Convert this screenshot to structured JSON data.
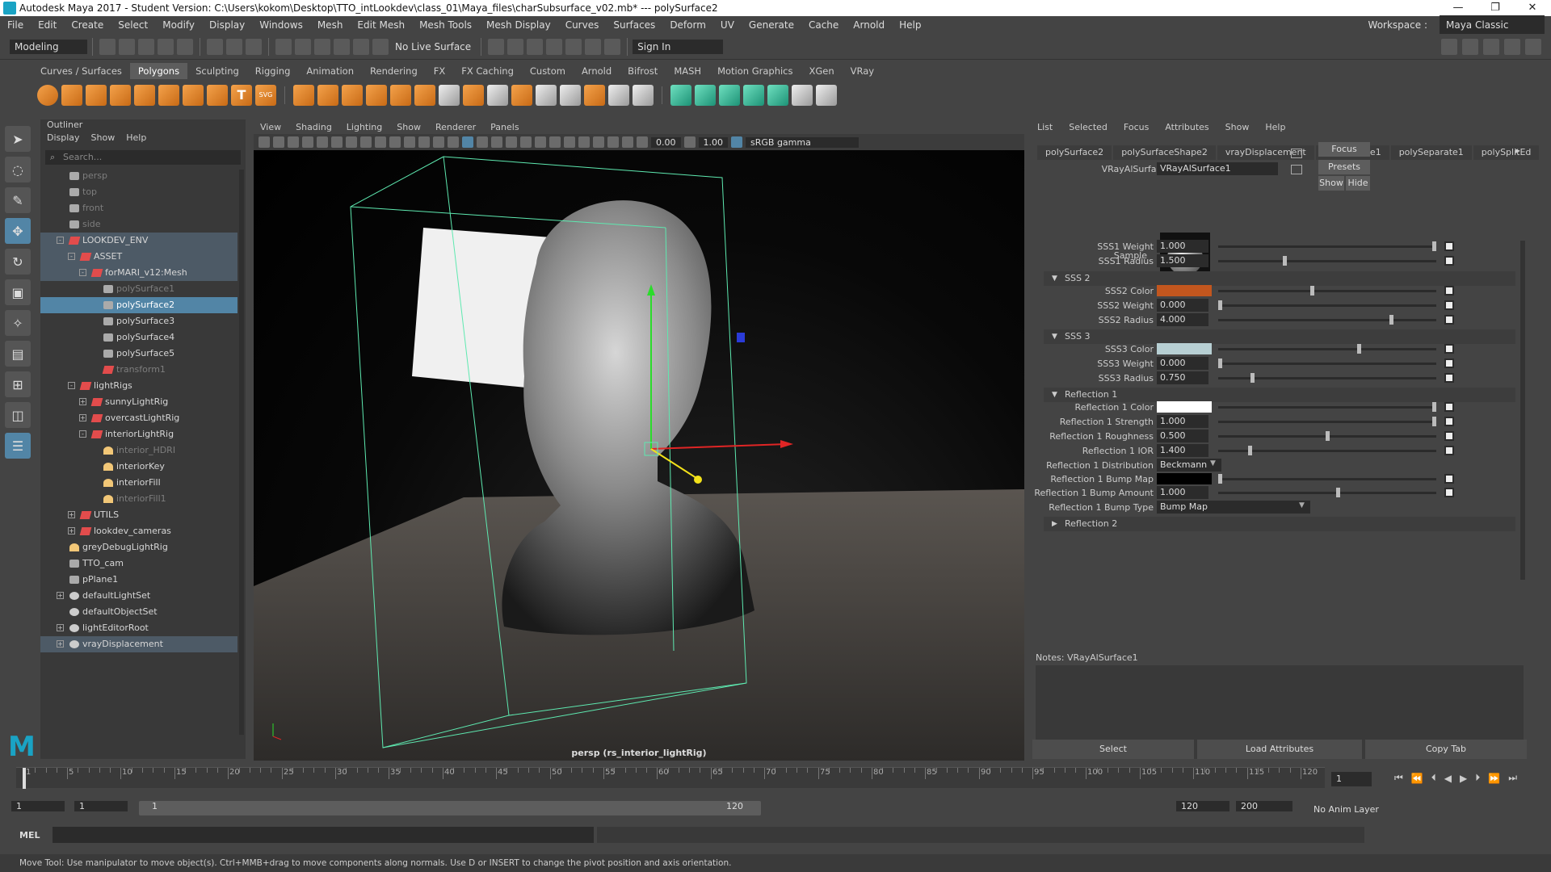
{
  "window": {
    "title": "Autodesk Maya 2017 - Student Version: C:\\Users\\kokom\\Desktop\\TTO_intLookdev\\class_01\\Maya_files\\charSubsurface_v02.mb*   ---   polySurface2",
    "controls": [
      "—",
      "❐",
      "✕"
    ]
  },
  "menubar": {
    "items": [
      "File",
      "Edit",
      "Create",
      "Select",
      "Modify",
      "Display",
      "Windows",
      "Mesh",
      "Edit Mesh",
      "Mesh Tools",
      "Mesh Display",
      "Curves",
      "Surfaces",
      "Deform",
      "UV",
      "Generate",
      "Cache",
      "Arnold",
      "Help"
    ],
    "workspace_label": "Workspace :",
    "workspace_value": "Maya Classic"
  },
  "statusline": {
    "mode": "Modeling",
    "live_surface": "No Live Surface",
    "sign_in": "Sign In"
  },
  "shelf": {
    "tabs": [
      "Curves / Surfaces",
      "Polygons",
      "Sculpting",
      "Rigging",
      "Animation",
      "Rendering",
      "FX",
      "FX Caching",
      "Custom",
      "Arnold",
      "Bifrost",
      "MASH",
      "Motion Graphics",
      "XGen",
      "VRay"
    ],
    "active": "Polygons",
    "svg_label": "SVG",
    "text_label": "T"
  },
  "outliner": {
    "title": "Outliner",
    "menu": [
      "Display",
      "Show",
      "Help"
    ],
    "search_placeholder": "Search...",
    "rows": [
      {
        "label": "persp",
        "depth": 1,
        "icon": "camera",
        "dim": true
      },
      {
        "label": "top",
        "depth": 1,
        "icon": "camera",
        "dim": true
      },
      {
        "label": "front",
        "depth": 1,
        "icon": "camera",
        "dim": true
      },
      {
        "label": "side",
        "depth": 1,
        "icon": "camera",
        "dim": true
      },
      {
        "label": "LOOKDEV_ENV",
        "depth": 1,
        "icon": "grp",
        "ex": "-",
        "hl": true
      },
      {
        "label": "ASSET",
        "depth": 2,
        "icon": "grp",
        "ex": "-",
        "hl": true
      },
      {
        "label": "forMARI_v12:Mesh",
        "depth": 3,
        "icon": "grp",
        "ex": "-",
        "hl": true
      },
      {
        "label": "polySurface1",
        "depth": 4,
        "icon": "mesh",
        "dim": true
      },
      {
        "label": "polySurface2",
        "depth": 4,
        "icon": "mesh",
        "sel": true
      },
      {
        "label": "polySurface3",
        "depth": 4,
        "icon": "mesh"
      },
      {
        "label": "polySurface4",
        "depth": 4,
        "icon": "mesh"
      },
      {
        "label": "polySurface5",
        "depth": 4,
        "icon": "mesh"
      },
      {
        "label": "transform1",
        "depth": 4,
        "icon": "grp",
        "dim": true
      },
      {
        "label": "lightRigs",
        "depth": 2,
        "icon": "grp",
        "ex": "-"
      },
      {
        "label": "sunnyLightRig",
        "depth": 3,
        "icon": "grp",
        "ex": "+"
      },
      {
        "label": "overcastLightRig",
        "depth": 3,
        "icon": "grp",
        "ex": "+"
      },
      {
        "label": "interiorLightRig",
        "depth": 3,
        "icon": "grp",
        "ex": "-"
      },
      {
        "label": "interior_HDRI",
        "depth": 4,
        "icon": "light",
        "dim": true
      },
      {
        "label": "interiorKey",
        "depth": 4,
        "icon": "light"
      },
      {
        "label": "interiorFill",
        "depth": 4,
        "icon": "light"
      },
      {
        "label": "interiorFill1",
        "depth": 4,
        "icon": "light",
        "dim": true
      },
      {
        "label": "UTILS",
        "depth": 2,
        "icon": "grp",
        "ex": "+"
      },
      {
        "label": "lookdev_cameras",
        "depth": 2,
        "icon": "grp",
        "ex": "+"
      },
      {
        "label": "greyDebugLightRig",
        "depth": 1,
        "icon": "light"
      },
      {
        "label": "TTO_cam",
        "depth": 1,
        "icon": "camera"
      },
      {
        "label": "pPlane1",
        "depth": 1,
        "icon": "mesh"
      },
      {
        "label": "defaultLightSet",
        "depth": 1,
        "icon": "set",
        "ex": "+"
      },
      {
        "label": "defaultObjectSet",
        "depth": 1,
        "icon": "set"
      },
      {
        "label": "lightEditorRoot",
        "depth": 1,
        "icon": "set",
        "ex": "+"
      },
      {
        "label": "vrayDisplacement",
        "depth": 1,
        "icon": "set",
        "ex": "+",
        "hl": true
      }
    ]
  },
  "viewport": {
    "menu": [
      "View",
      "Shading",
      "Lighting",
      "Show",
      "Renderer",
      "Panels"
    ],
    "field_a": "0.00",
    "field_b": "1.00",
    "color_space": "sRGB gamma",
    "camera_label": "persp (rs_interior_lightRig)"
  },
  "attribute_editor": {
    "menu": [
      "List",
      "Selected",
      "Focus",
      "Attributes",
      "Show",
      "Help"
    ],
    "tabs": [
      "polySurface2",
      "polySurfaceShape2",
      "vrayDisplacement",
      "polyReduce1",
      "polySeparate1",
      "polySplitEd"
    ],
    "node_label": "VRayAlSurface:",
    "node_value": "VRayAlSurface1",
    "focus_btn": "Focus",
    "presets_btn": "Presets",
    "show_btn": "Show",
    "hide_btn": "Hide",
    "sample_label": "Sample",
    "sss1_weight_label": "SSS1 Weight",
    "sss1_weight": "1.000",
    "sss1_weight_slider": 1.0,
    "sss1_radius_label": "SSS1 Radius",
    "sss1_radius": "1.500",
    "sss1_radius_slider": 0.3,
    "sss2_section": "SSS 2",
    "sss2_color_label": "SSS2 Color",
    "sss2_color": "#c2561e",
    "sss2_color_slider": 0.43,
    "sss2_weight_label": "SSS2 Weight",
    "sss2_weight": "0.000",
    "sss2_weight_slider": 0.0,
    "sss2_radius_label": "SSS2 Radius",
    "sss2_radius": "4.000",
    "sss2_radius_slider": 0.8,
    "sss3_section": "SSS 3",
    "sss3_color_label": "SSS3 Color",
    "sss3_color": "#b7cfd3",
    "sss3_color_slider": 0.65,
    "sss3_weight_label": "SSS3 Weight",
    "sss3_weight": "0.000",
    "sss3_weight_slider": 0.0,
    "sss3_radius_label": "SSS3 Radius",
    "sss3_radius": "0.750",
    "sss3_radius_slider": 0.15,
    "refl1_section": "Reflection 1",
    "refl1_color_label": "Reflection 1 Color",
    "refl1_color": "#ffffff",
    "refl1_color_slider": 1.0,
    "refl1_strength_label": "Reflection 1 Strength",
    "refl1_strength": "1.000",
    "refl1_strength_slider": 1.0,
    "refl1_rough_label": "Reflection 1 Roughness",
    "refl1_rough": "0.500",
    "refl1_rough_slider": 0.5,
    "refl1_ior_label": "Reflection 1 IOR",
    "refl1_ior": "1.400",
    "refl1_ior_slider": 0.14,
    "refl1_dist_label": "Reflection 1 Distribution",
    "refl1_dist": "Beckmann",
    "refl1_bumpmap_label": "Reflection 1 Bump Map",
    "refl1_bumpmap_color": "#000000",
    "refl1_bumpamt_label": "Reflection 1 Bump Amount",
    "refl1_bumpamt": "1.000",
    "refl1_bumpamt_slider": 0.55,
    "refl1_bumptype_label": "Reflection 1 Bump Type",
    "refl1_bumptype": "Bump Map",
    "refl2_section": "Reflection 2",
    "notes_label": "Notes: VRayAlSurface1",
    "select_btn": "Select",
    "load_btn": "Load Attributes",
    "copy_btn": "Copy Tab"
  },
  "timeline": {
    "ticks": [
      "1",
      "5",
      "10",
      "15",
      "20",
      "25",
      "30",
      "35",
      "40",
      "45",
      "50",
      "55",
      "60",
      "65",
      "70",
      "75",
      "80",
      "85",
      "90",
      "95",
      "100",
      "105",
      "110",
      "115",
      "120"
    ],
    "current_frame": "1"
  },
  "range": {
    "start": "1",
    "playback_start": "1",
    "slider_start": "1",
    "slider_end": "120",
    "playback_end": "120",
    "end": "200",
    "anim_layer": "No Anim Layer"
  },
  "cmdline": {
    "label": "MEL"
  },
  "helpline": "Move Tool: Use manipulator to move object(s). Ctrl+MMB+drag to move components along normals. Use D or INSERT to change the pivot position and axis orientation."
}
